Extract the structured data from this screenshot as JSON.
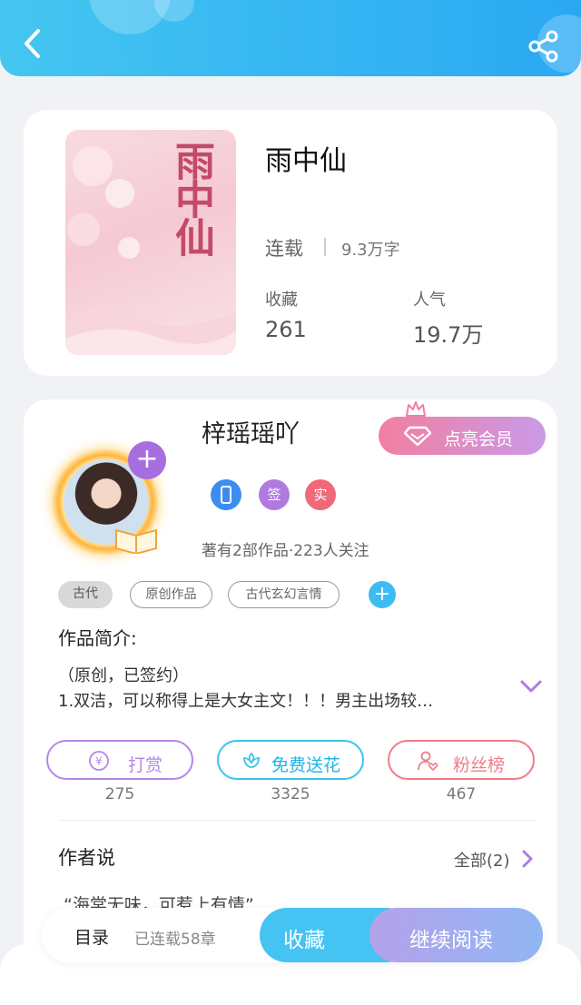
{
  "book": {
    "title": "雨中仙",
    "cover_text": "雨中仙",
    "status": "连载",
    "word_count": "9.3万字",
    "favorites_label": "收藏",
    "favorites_value": "261",
    "popularity_label": "人气",
    "popularity_value": "19.7万"
  },
  "author": {
    "name": "梓瑶瑶吖",
    "vip_button": "点亮会员",
    "badges": [
      {
        "icon": "phone-badge-icon",
        "text": "",
        "color": "#3c8df0"
      },
      {
        "icon": "signed-badge-icon",
        "text": "签",
        "color": "#b07ae0"
      },
      {
        "icon": "verified-badge-icon",
        "text": "实",
        "color": "#f0697a"
      }
    ],
    "meta": "著有2部作品·223人关注",
    "follow_plus": "+"
  },
  "tags": [
    "古代",
    "原创作品",
    "古代玄幻言情"
  ],
  "tag_add": "+",
  "intro": {
    "title": "作品简介:",
    "line1": "（原创，已签约）",
    "line2": "1.双洁，可以称得上是大女主文！！！男主出场较…"
  },
  "actions": [
    {
      "label": "打赏",
      "count": "275",
      "color": "#b487e6",
      "icon": "yuan-coin-icon"
    },
    {
      "label": "免费送花",
      "count": "3325",
      "color": "#3cc3ec",
      "icon": "flower-icon"
    },
    {
      "label": "粉丝榜",
      "count": "467",
      "color": "#ef7c86",
      "icon": "fan-heart-icon"
    }
  ],
  "author_says": {
    "title": "作者说",
    "all_link": "全部(2)",
    "quote": "“海棠无味，可惹上有情”"
  },
  "bottom": {
    "toc_label": "目录",
    "chapter_count": "已连载58章",
    "favorite_button": "收藏",
    "read_button": "继续阅读"
  },
  "colors": {
    "header_blue": "#2aa8f2",
    "accent_purple": "#a86de0"
  }
}
